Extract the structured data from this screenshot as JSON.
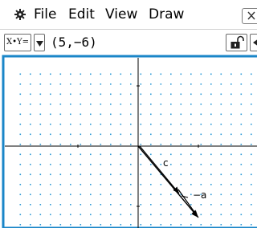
{
  "menu": {
    "items": [
      "File",
      "Edit",
      "View",
      "Draw"
    ],
    "icons": {
      "settings": "gear-icon",
      "close": "close-icon"
    }
  },
  "toolbar": {
    "mode_label": "X•Y=",
    "entry_value": "(5,−6)",
    "icons": {
      "dropdown": "triangle-down-icon",
      "lock": "padlock-open-icon",
      "scroll": "triangle-left-icon"
    }
  },
  "graph": {
    "vector_labels": [
      "c",
      "−a"
    ],
    "colors": {
      "frame": "#1a86c8",
      "grid_dots": "#2b9bd8",
      "axes": "#000000"
    }
  }
}
